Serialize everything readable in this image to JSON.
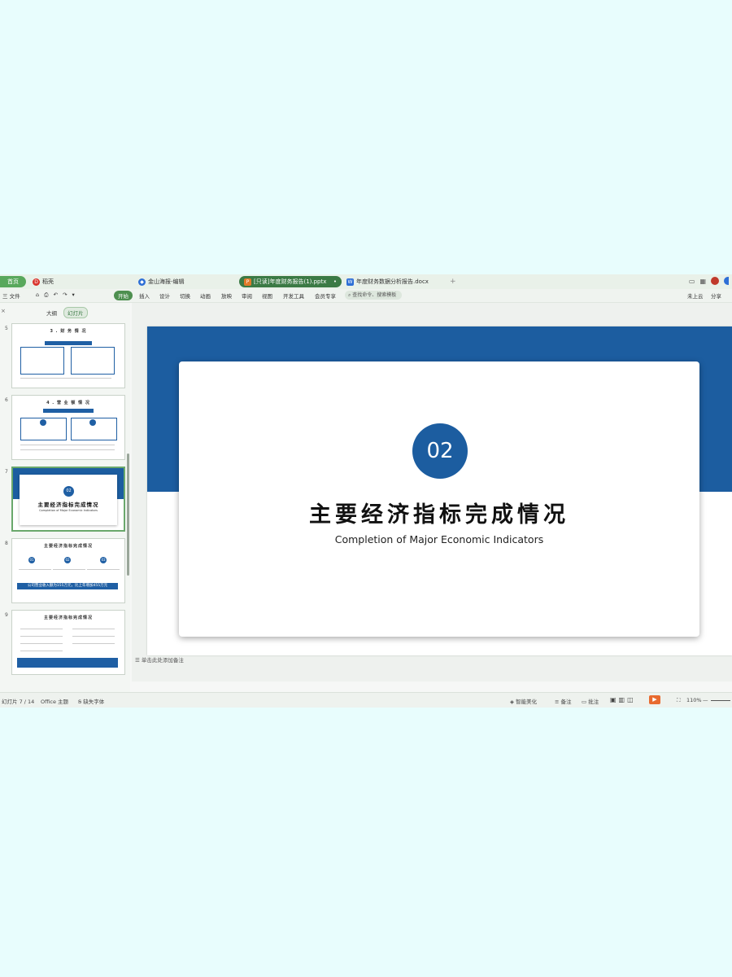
{
  "tabs": {
    "home": "首页",
    "tab1": "稻壳",
    "tab2": "金山海报-编辑",
    "tab3_active": "[只读]年度财务报告(1).pptx",
    "tab4": "年度财务数据分析报告.docx",
    "add": "+"
  },
  "ribbon": {
    "file": "三 文件",
    "items": [
      "开始",
      "插入",
      "设计",
      "切换",
      "动画",
      "放映",
      "审阅",
      "视图",
      "开发工具",
      "会员专享"
    ],
    "search_placeholder": "查找命令、搜索模板",
    "right_items": [
      "未上云",
      "分享"
    ]
  },
  "panel": {
    "outline": "大纲",
    "slides_tab": "幻灯片",
    "thumbs": [
      {
        "num": "5",
        "title": "3 . 财 务 情 况"
      },
      {
        "num": "6",
        "title": "4 . 营 业 额 情 况"
      },
      {
        "num": "7",
        "title": "主要经济指标完成情况",
        "subtitle": "Completion of Major Economic Indicators",
        "badge": "02"
      },
      {
        "num": "8",
        "title": "主要经济指标完成情况",
        "bar": "公司营业收入额为155万元，比上年增加455万元",
        "circles": [
          "01",
          "02",
          "03"
        ]
      },
      {
        "num": "9",
        "title": "主要经济指标完成情况"
      }
    ],
    "add": "+"
  },
  "slide": {
    "number": "02",
    "title": "主要经济指标完成情况",
    "subtitle": "Completion of Major Economic Indicators"
  },
  "notes_placeholder": "单击此处添加备注",
  "status": {
    "slide_counter": "幻灯片 7 / 14",
    "theme": "Office 主题",
    "font_missing": "缺失字体",
    "smart_beautify": "智能美化",
    "notes": "备注",
    "comments": "批注",
    "zoom": "110%"
  },
  "colors": {
    "brand_blue": "#1c5da0",
    "tab_green": "#3b7a45"
  }
}
